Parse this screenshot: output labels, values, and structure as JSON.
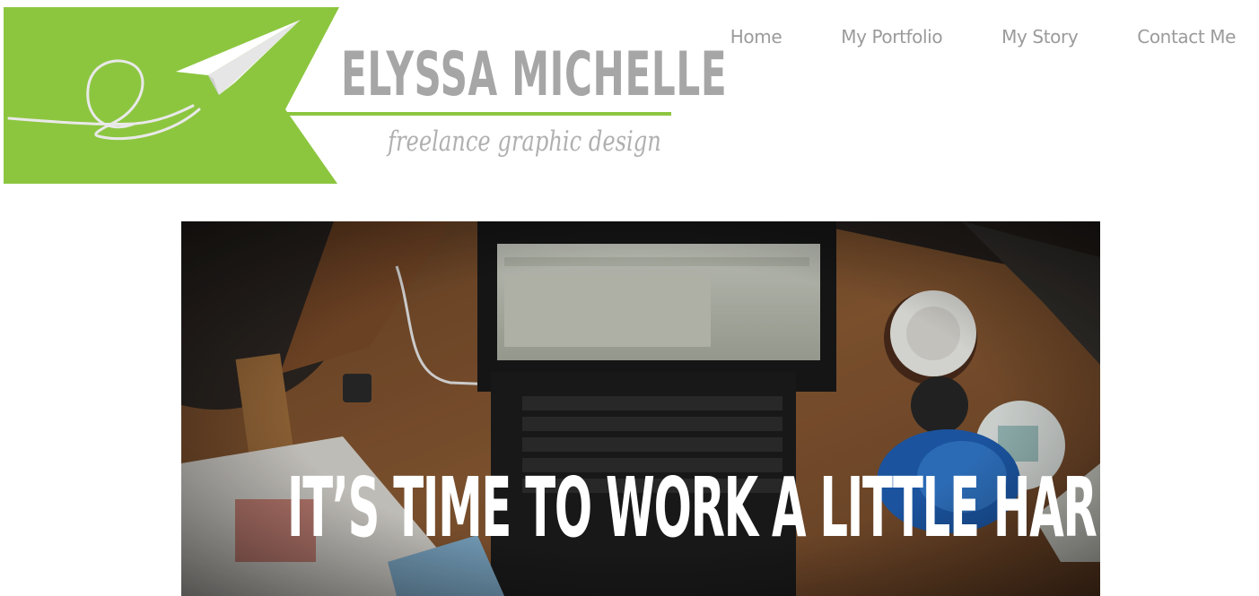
{
  "brand": {
    "name": "ELYSSA MICHELLE",
    "tagline": "freelance graphic design",
    "accent_color": "#8cc63f",
    "logo_icon": "paper-airplane-icon"
  },
  "nav": {
    "items": [
      {
        "label": "Home"
      },
      {
        "label": "My Portfolio"
      },
      {
        "label": "My Story"
      },
      {
        "label": "Contact Me"
      }
    ]
  },
  "hero": {
    "headline": "IT’S TIME TO WORK A LITTLE HARDER.",
    "image_description_icon": "desk-laptop-photo"
  }
}
